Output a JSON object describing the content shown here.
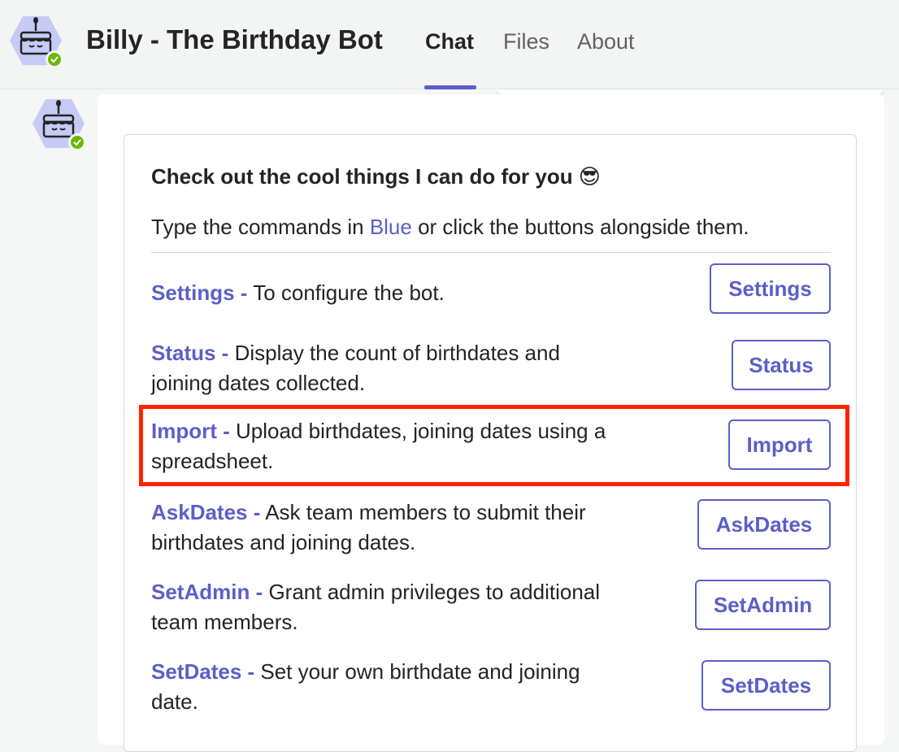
{
  "app": {
    "title": "Billy - The Birthday Bot",
    "avatar_icon": "birthday-cake-icon",
    "status_icon": "available-check-icon",
    "status_color": "#6bb700"
  },
  "tabs": [
    {
      "label": "Chat",
      "active": true
    },
    {
      "label": "Files",
      "active": false
    },
    {
      "label": "About",
      "active": false
    }
  ],
  "colors": {
    "accent": "#5b5fc7",
    "highlight": "#ff2200"
  },
  "card": {
    "title": "Check out the cool things I can do for you 😎",
    "subtitle_before": "Type the commands in ",
    "subtitle_blue": "Blue",
    "subtitle_after": " or click the buttons alongside them.",
    "commands": [
      {
        "name": "Settings -",
        "description": " To configure the bot.",
        "button": "Settings"
      },
      {
        "name": "Status -",
        "description": " Display the count of birthdates and joining dates collected.",
        "button": "Status"
      },
      {
        "name": "Import -",
        "description": " Upload birthdates, joining dates using a spreadsheet.",
        "button": "Import"
      },
      {
        "name": "AskDates -",
        "description": " Ask team members to submit their birthdates and joining dates.",
        "button": "AskDates"
      },
      {
        "name": "SetAdmin -",
        "description": " Grant admin privileges to additional team members.",
        "button": "SetAdmin"
      },
      {
        "name": "SetDates -",
        "description": " Set your own birthdate and joining date.",
        "button": "SetDates"
      }
    ]
  }
}
